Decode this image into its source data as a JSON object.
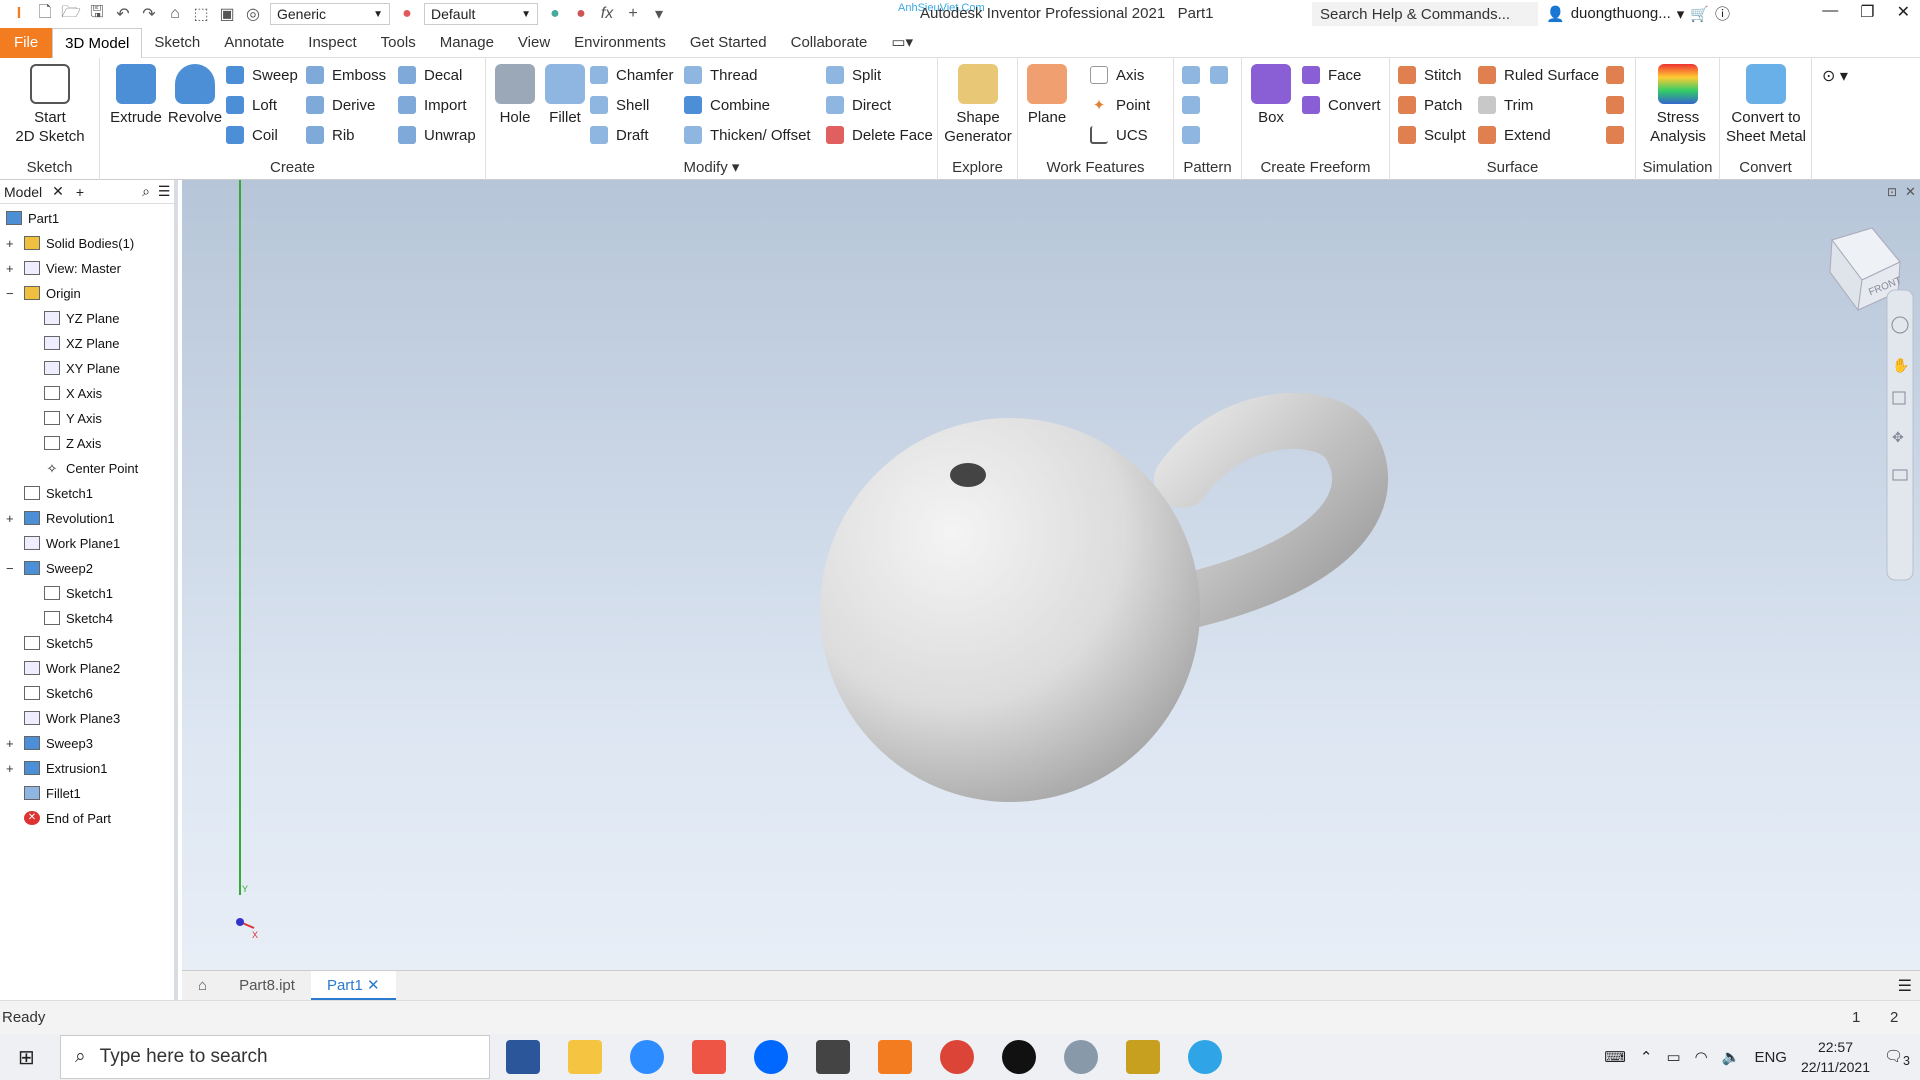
{
  "app": {
    "title": "Autodesk Inventor Professional 2021",
    "doc": "Part1",
    "brand": "AnhSieuViet.Com"
  },
  "quick_access": {
    "material": "Generic",
    "appearance": "Default"
  },
  "search": {
    "placeholder": "Search Help & Commands..."
  },
  "user": {
    "name": "duongthuong..."
  },
  "tabs": [
    "File",
    "3D Model",
    "Sketch",
    "Annotate",
    "Inspect",
    "Tools",
    "Manage",
    "View",
    "Environments",
    "Get Started",
    "Collaborate"
  ],
  "ribbon": {
    "sketch": {
      "title": "Sketch",
      "start": "Start\n2D Sketch"
    },
    "create": {
      "title": "Create",
      "extrude": "Extrude",
      "revolve": "Revolve",
      "sweep": "Sweep",
      "loft": "Loft",
      "coil": "Coil",
      "emboss": "Emboss",
      "derive": "Derive",
      "rib": "Rib",
      "decal": "Decal",
      "import": "Import",
      "unwrap": "Unwrap"
    },
    "modify": {
      "title": "Modify",
      "hole": "Hole",
      "fillet": "Fillet",
      "chamfer": "Chamfer",
      "shell": "Shell",
      "draft": "Draft",
      "thread": "Thread",
      "combine": "Combine",
      "thicken": "Thicken/ Offset",
      "split": "Split",
      "direct": "Direct",
      "delete_face": "Delete Face"
    },
    "explore": {
      "title": "Explore",
      "shape_gen": "Shape\nGenerator"
    },
    "work": {
      "title": "Work Features",
      "plane": "Plane",
      "axis": "Axis",
      "point": "Point",
      "ucs": "UCS"
    },
    "pattern": {
      "title": "Pattern"
    },
    "freeform": {
      "title": "Create Freeform",
      "box": "Box",
      "face": "Face",
      "convert": "Convert"
    },
    "surface": {
      "title": "Surface",
      "stitch": "Stitch",
      "patch": "Patch",
      "sculpt": "Sculpt",
      "ruled": "Ruled Surface",
      "trim": "Trim",
      "extend": "Extend"
    },
    "simulation": {
      "title": "Simulation",
      "stress": "Stress\nAnalysis"
    },
    "convert": {
      "title": "Convert",
      "sheet": "Convert to\nSheet Metal"
    }
  },
  "browser": {
    "tab": "Model",
    "root": "Part1",
    "items": [
      "Solid Bodies(1)",
      "View: Master",
      "Origin",
      "YZ Plane",
      "XZ Plane",
      "XY Plane",
      "X Axis",
      "Y Axis",
      "Z Axis",
      "Center Point",
      "Sketch1",
      "Revolution1",
      "Work Plane1",
      "Sweep2",
      "Sketch1",
      "Sketch4",
      "Sketch5",
      "Work Plane2",
      "Sketch6",
      "Work Plane3",
      "Sweep3",
      "Extrusion1",
      "Fillet1",
      "End of Part"
    ]
  },
  "viewcube": {
    "label": "FRONT"
  },
  "doc_tabs": [
    "Part8.ipt",
    "Part1"
  ],
  "status": {
    "text": "Ready",
    "n1": "1",
    "n2": "2"
  },
  "taskbar": {
    "search": "Type here to search",
    "lang": "ENG",
    "time": "22:57",
    "date": "22/11/2021",
    "notif": "3"
  }
}
